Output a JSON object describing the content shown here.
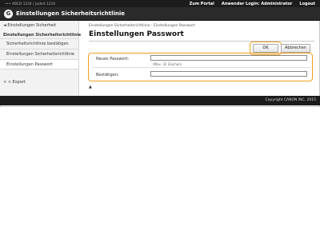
{
  "topbar": {
    "device": "••• ABCD 1234 / Jadeit 1234",
    "portal": "Zum Portal",
    "user": "Anwender Login: Administrator",
    "logout": "Logout"
  },
  "header": {
    "logo": "G",
    "title": "Einstellungen Sicherheitsrichtlinie"
  },
  "sidebar": {
    "back": "◄ Einstellungen Sicherheit",
    "section": "Einstellungen Sicherheitsrichtlinie",
    "items": [
      {
        "label": "Sicherheitsrichtlinie bestätigen"
      },
      {
        "label": "Einstellungen Sicherheitsrichtlinie"
      },
      {
        "label": "Einstellungen Passwort"
      }
    ],
    "export": "< < Export"
  },
  "main": {
    "breadcrumb": "Einstellungen Sicherheitsrichtlinie : Einstellungen Passwort",
    "title": "Einstellungen Passwort",
    "ok_label": "OK",
    "cancel_label": "Abbrechen",
    "new_password_label": "Neues Passwort:",
    "new_password_value": "",
    "new_password_hint": "(Max. 32 Zeichen)",
    "confirm_label": "Bestätigen:",
    "confirm_value": "",
    "top_icon": "▲"
  },
  "footer": {
    "copyright": "Copyright CANON INC. 2015"
  },
  "colors": {
    "highlight": "#f0a020",
    "header": "#2a2a2a",
    "topbar": "#1c1c1c"
  }
}
